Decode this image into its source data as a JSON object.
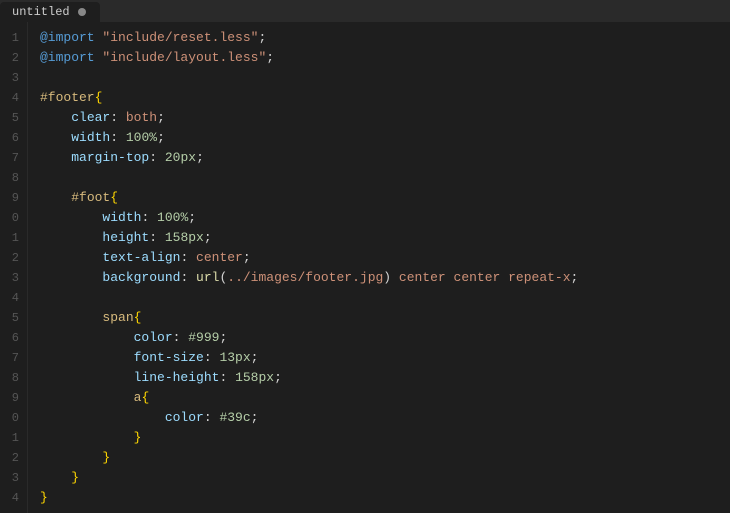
{
  "tab": {
    "title": "untitled",
    "dot_color": "#888888"
  },
  "editor": {
    "lines": [
      {
        "number": "1",
        "tokens": [
          {
            "type": "at-rule",
            "text": "@import"
          },
          {
            "type": "plain",
            "text": " "
          },
          {
            "type": "string",
            "text": "\"include/reset.less\""
          },
          {
            "type": "plain",
            "text": ";"
          }
        ]
      },
      {
        "number": "2",
        "tokens": [
          {
            "type": "at-rule",
            "text": "@import"
          },
          {
            "type": "plain",
            "text": " "
          },
          {
            "type": "string",
            "text": "\"include/layout.less\""
          },
          {
            "type": "plain",
            "text": ";"
          }
        ]
      },
      {
        "number": "3",
        "tokens": []
      },
      {
        "number": "4",
        "tokens": [
          {
            "type": "selector-id",
            "text": "#footer"
          },
          {
            "type": "brace",
            "text": "{"
          }
        ]
      },
      {
        "number": "5",
        "tokens": [
          {
            "type": "plain",
            "text": "    "
          },
          {
            "type": "property",
            "text": "clear"
          },
          {
            "type": "plain",
            "text": ": "
          },
          {
            "type": "value",
            "text": "both"
          },
          {
            "type": "plain",
            "text": ";"
          }
        ]
      },
      {
        "number": "6",
        "tokens": [
          {
            "type": "plain",
            "text": "    "
          },
          {
            "type": "property",
            "text": "width"
          },
          {
            "type": "plain",
            "text": ": "
          },
          {
            "type": "value-num",
            "text": "100%"
          },
          {
            "type": "plain",
            "text": ";"
          }
        ]
      },
      {
        "number": "7",
        "tokens": [
          {
            "type": "plain",
            "text": "    "
          },
          {
            "type": "property",
            "text": "margin-top"
          },
          {
            "type": "plain",
            "text": ": "
          },
          {
            "type": "value-num",
            "text": "20px"
          },
          {
            "type": "plain",
            "text": ";"
          }
        ]
      },
      {
        "number": "8",
        "tokens": []
      },
      {
        "number": "9",
        "tokens": [
          {
            "type": "plain",
            "text": "    "
          },
          {
            "type": "selector-id",
            "text": "#foot"
          },
          {
            "type": "brace",
            "text": "{"
          }
        ]
      },
      {
        "number": "0",
        "tokens": [
          {
            "type": "plain",
            "text": "        "
          },
          {
            "type": "property",
            "text": "width"
          },
          {
            "type": "plain",
            "text": ": "
          },
          {
            "type": "value-num",
            "text": "100%"
          },
          {
            "type": "plain",
            "text": ";"
          }
        ]
      },
      {
        "number": "1",
        "tokens": [
          {
            "type": "plain",
            "text": "        "
          },
          {
            "type": "property",
            "text": "height"
          },
          {
            "type": "plain",
            "text": ": "
          },
          {
            "type": "value-num",
            "text": "158px"
          },
          {
            "type": "plain",
            "text": ";"
          }
        ]
      },
      {
        "number": "2",
        "tokens": [
          {
            "type": "plain",
            "text": "        "
          },
          {
            "type": "property",
            "text": "text-align"
          },
          {
            "type": "plain",
            "text": ": "
          },
          {
            "type": "value",
            "text": "center"
          },
          {
            "type": "plain",
            "text": ";"
          }
        ]
      },
      {
        "number": "3",
        "tokens": [
          {
            "type": "plain",
            "text": "        "
          },
          {
            "type": "property",
            "text": "background"
          },
          {
            "type": "plain",
            "text": ": "
          },
          {
            "type": "url-func",
            "text": "url"
          },
          {
            "type": "plain",
            "text": "("
          },
          {
            "type": "string",
            "text": "../images/footer.jpg"
          },
          {
            "type": "plain",
            "text": ") "
          },
          {
            "type": "value",
            "text": "center center repeat-x"
          },
          {
            "type": "plain",
            "text": ";"
          }
        ]
      },
      {
        "number": "4",
        "tokens": []
      },
      {
        "number": "5",
        "tokens": [
          {
            "type": "plain",
            "text": "        "
          },
          {
            "type": "selector",
            "text": "span"
          },
          {
            "type": "brace",
            "text": "{"
          }
        ]
      },
      {
        "number": "6",
        "tokens": [
          {
            "type": "plain",
            "text": "            "
          },
          {
            "type": "property",
            "text": "color"
          },
          {
            "type": "plain",
            "text": ": "
          },
          {
            "type": "value-color",
            "text": "#999"
          },
          {
            "type": "plain",
            "text": ";"
          }
        ]
      },
      {
        "number": "7",
        "tokens": [
          {
            "type": "plain",
            "text": "            "
          },
          {
            "type": "property",
            "text": "font-size"
          },
          {
            "type": "plain",
            "text": ": "
          },
          {
            "type": "value-num",
            "text": "13px"
          },
          {
            "type": "plain",
            "text": ";"
          }
        ]
      },
      {
        "number": "8",
        "tokens": [
          {
            "type": "plain",
            "text": "            "
          },
          {
            "type": "property",
            "text": "line-height"
          },
          {
            "type": "plain",
            "text": ": "
          },
          {
            "type": "value-num",
            "text": "158px"
          },
          {
            "type": "plain",
            "text": ";"
          }
        ]
      },
      {
        "number": "9",
        "tokens": [
          {
            "type": "plain",
            "text": "            "
          },
          {
            "type": "selector",
            "text": "a"
          },
          {
            "type": "brace",
            "text": "{"
          }
        ]
      },
      {
        "number": "0",
        "tokens": [
          {
            "type": "plain",
            "text": "                "
          },
          {
            "type": "property",
            "text": "color"
          },
          {
            "type": "plain",
            "text": ": "
          },
          {
            "type": "value-color",
            "text": "#39c"
          },
          {
            "type": "plain",
            "text": ";"
          }
        ]
      },
      {
        "number": "1",
        "tokens": [
          {
            "type": "plain",
            "text": "            "
          },
          {
            "type": "brace",
            "text": "}"
          }
        ]
      },
      {
        "number": "2",
        "tokens": [
          {
            "type": "plain",
            "text": "        "
          },
          {
            "type": "brace",
            "text": "}"
          }
        ]
      },
      {
        "number": "3",
        "tokens": [
          {
            "type": "plain",
            "text": "    "
          },
          {
            "type": "brace",
            "text": "}"
          }
        ]
      },
      {
        "number": "4",
        "tokens": [
          {
            "type": "brace",
            "text": "}"
          }
        ]
      }
    ]
  }
}
